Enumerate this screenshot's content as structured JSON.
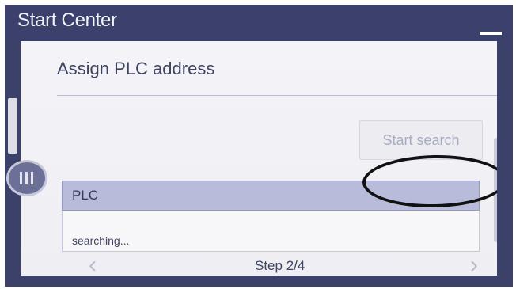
{
  "titlebar": {
    "title": "Start Center",
    "minimize_icon": "minimize-icon"
  },
  "main": {
    "heading": "Assign PLC address",
    "start_search_label": "Start search",
    "table": {
      "header": "PLC",
      "status": "searching..."
    }
  },
  "navigation": {
    "prev_symbol": "‹",
    "next_symbol": "›",
    "step_label": "Step 2/4"
  },
  "side_menu": {
    "icon": "menu-handle-icon"
  },
  "colors": {
    "titlebar": "#3b416c",
    "panel": "#f1f1f5",
    "table_header": "#b8bbd9",
    "annotation": "#111111"
  }
}
